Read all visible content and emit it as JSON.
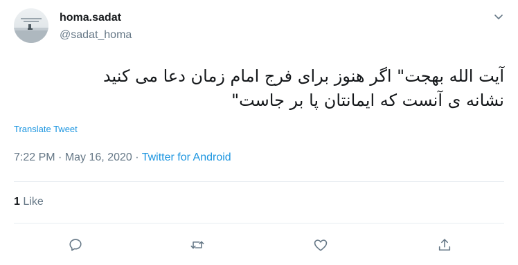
{
  "author": {
    "display_name": "homa.sadat",
    "handle": "@sadat_homa"
  },
  "tweet": {
    "line1": "آیت الله بهجت\" اگر هنوز برای فرج امام زمان دعا می کنید",
    "line2": "نشانه ی آنست که ایمانتان پا بر جاست\""
  },
  "translate_label": "Translate Tweet",
  "meta": {
    "time": "7:22 PM",
    "separator1": "·",
    "date": "May 16, 2020",
    "separator2": "·",
    "source": "Twitter for Android"
  },
  "stats": {
    "likes_count": "1",
    "likes_label": "Like"
  },
  "icons": {
    "menu": "chevron-down-icon",
    "reply": "reply-icon",
    "retweet": "retweet-icon",
    "like": "heart-icon",
    "share": "share-icon"
  },
  "colors": {
    "text": "#14171a",
    "secondary": "#657786",
    "link": "#1b95e0",
    "divider": "#e6ecf0"
  }
}
